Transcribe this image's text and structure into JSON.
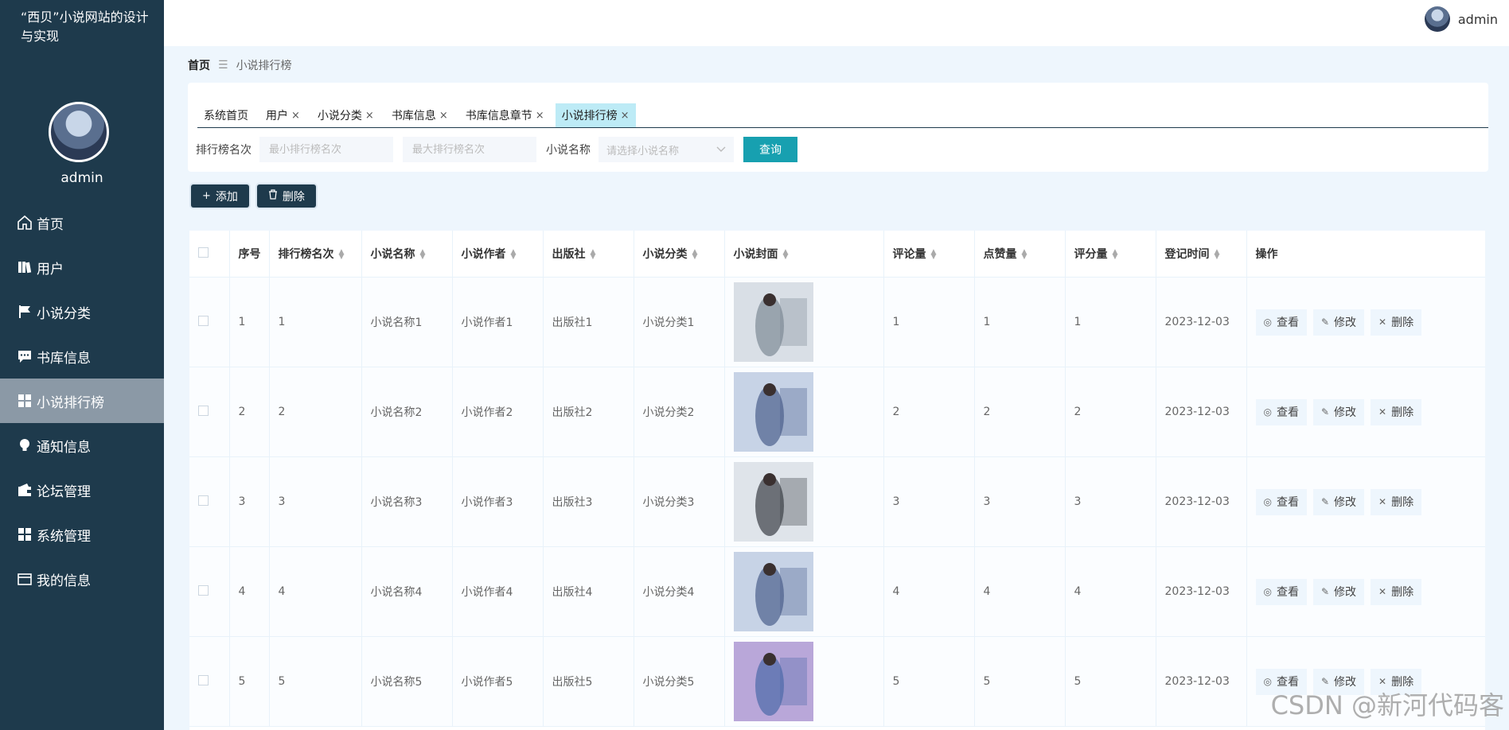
{
  "app": {
    "title": "“西贝”小说网站的设计与实现",
    "user_name": "admin"
  },
  "sidebar": {
    "items": [
      {
        "label": "首页",
        "icon": "home-icon"
      },
      {
        "label": "用户",
        "icon": "book-icon"
      },
      {
        "label": "小说分类",
        "icon": "flag-icon"
      },
      {
        "label": "书库信息",
        "icon": "chat-icon"
      },
      {
        "label": "小说排行榜",
        "icon": "grid-icon",
        "active": true
      },
      {
        "label": "通知信息",
        "icon": "bulb-icon"
      },
      {
        "label": "论坛管理",
        "icon": "wallet-icon"
      },
      {
        "label": "系统管理",
        "icon": "grid-icon"
      },
      {
        "label": "我的信息",
        "icon": "card-icon"
      }
    ]
  },
  "breadcrumb": {
    "home": "首页",
    "current": "小说排行榜"
  },
  "tabs": [
    {
      "label": "系统首页",
      "closable": false
    },
    {
      "label": "用户",
      "closable": true
    },
    {
      "label": "小说分类",
      "closable": true
    },
    {
      "label": "书库信息",
      "closable": true
    },
    {
      "label": "书库信息章节",
      "closable": true
    },
    {
      "label": "小说排行榜",
      "closable": true,
      "active": true
    }
  ],
  "tab_close_glyph": "×",
  "filters": {
    "rank_label": "排行榜名次",
    "min_placeholder": "最小排行榜名次",
    "max_placeholder": "最大排行榜名次",
    "name_label": "小说名称",
    "name_placeholder": "请选择小说名称",
    "query_button": "查询"
  },
  "actions": {
    "add_label": "添加",
    "delete_label": "删除"
  },
  "table": {
    "columns": [
      "序号",
      "排行榜名次",
      "小说名称",
      "小说作者",
      "出版社",
      "小说分类",
      "小说封面",
      "评论量",
      "点赞量",
      "评分量",
      "登记时间",
      "操作"
    ],
    "rows": [
      {
        "index": "1",
        "rank": "1",
        "name": "小说名称1",
        "author": "小说作者1",
        "publisher": "出版社1",
        "category": "小说分类1",
        "comments": "1",
        "likes": "1",
        "ratings": "1",
        "date": "2023-12-03"
      },
      {
        "index": "2",
        "rank": "2",
        "name": "小说名称2",
        "author": "小说作者2",
        "publisher": "出版社2",
        "category": "小说分类2",
        "comments": "2",
        "likes": "2",
        "ratings": "2",
        "date": "2023-12-03"
      },
      {
        "index": "3",
        "rank": "3",
        "name": "小说名称3",
        "author": "小说作者3",
        "publisher": "出版社3",
        "category": "小说分类3",
        "comments": "3",
        "likes": "3",
        "ratings": "3",
        "date": "2023-12-03"
      },
      {
        "index": "4",
        "rank": "4",
        "name": "小说名称4",
        "author": "小说作者4",
        "publisher": "出版社4",
        "category": "小说分类4",
        "comments": "4",
        "likes": "4",
        "ratings": "4",
        "date": "2023-12-03"
      },
      {
        "index": "5",
        "rank": "5",
        "name": "小说名称5",
        "author": "小说作者5",
        "publisher": "出版社5",
        "category": "小说分类5",
        "comments": "5",
        "likes": "5",
        "ratings": "5",
        "date": "2023-12-03"
      }
    ],
    "row_actions": {
      "view": "查看",
      "edit": "修改",
      "delete": "删除"
    }
  },
  "watermark": "CSDN @新河代码客",
  "colors": {
    "sidebar": "#1e3a4c",
    "accent": "#17a0b0",
    "active_tab": "#bdebf6"
  }
}
